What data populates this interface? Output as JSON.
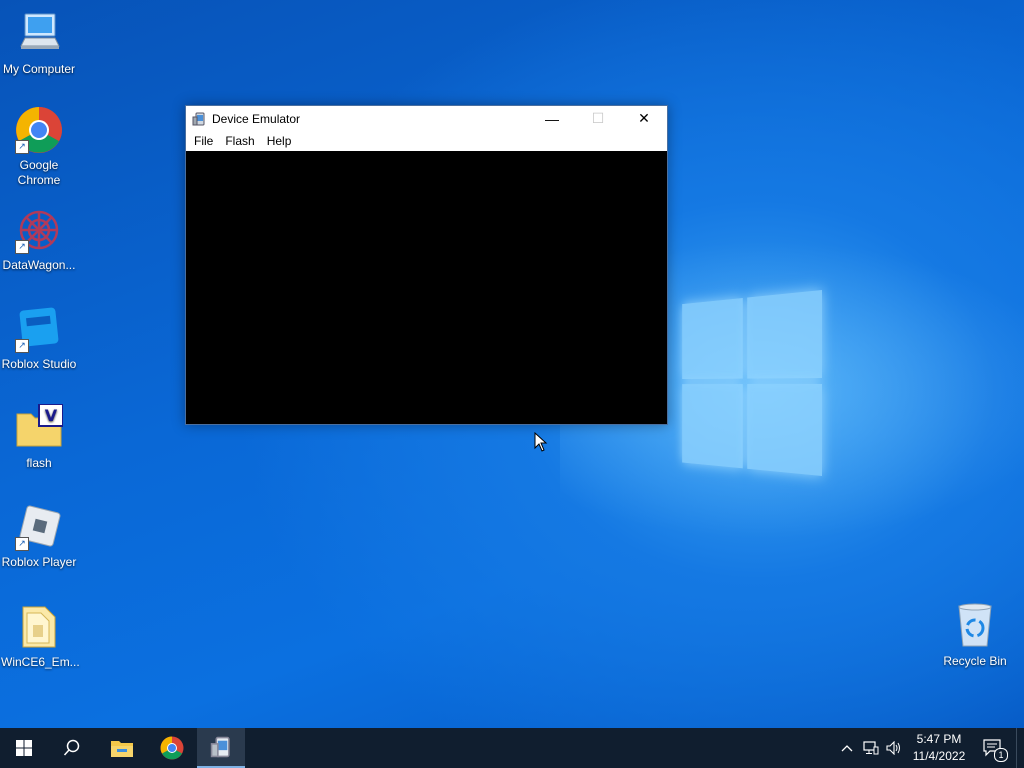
{
  "desktop": {
    "icons": [
      {
        "label": "My Computer"
      },
      {
        "label": "Google Chrome"
      },
      {
        "label": "DataWagon..."
      },
      {
        "label": "Roblox Studio"
      },
      {
        "label": "flash"
      },
      {
        "label": "Roblox Player"
      },
      {
        "label": "WinCE6_Em..."
      },
      {
        "label": "Recycle Bin"
      }
    ]
  },
  "window": {
    "title": "Device Emulator",
    "menu": [
      "File",
      "Flash",
      "Help"
    ],
    "controls": {
      "minimize": "—",
      "maximize": "☐",
      "close": "✕"
    }
  },
  "taskbar": {
    "clock": {
      "time": "5:47 PM",
      "date": "11/4/2022"
    },
    "notification_count": "1",
    "items": [
      "start-icon",
      "search-icon",
      "file-explorer-icon",
      "chrome-icon",
      "device-emulator-icon"
    ]
  },
  "colors": {
    "desktop_blue": "#0a68d6",
    "taskbar": "#101e2f",
    "emulator_screen": "#000000"
  }
}
